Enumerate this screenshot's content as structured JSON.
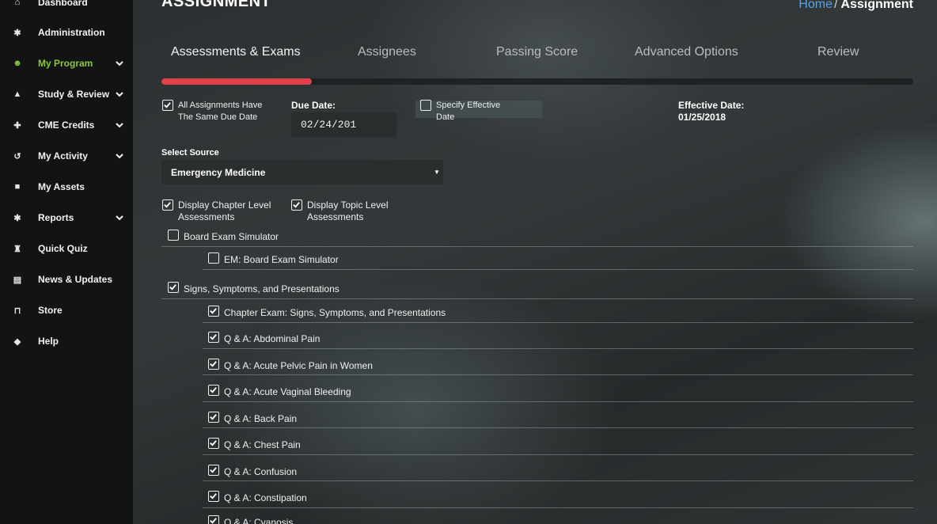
{
  "sidebar": {
    "items": [
      {
        "label": "Dashboard",
        "icon": "home-icon",
        "glyph": "⌂"
      },
      {
        "label": "Administration",
        "icon": "tools-icon",
        "glyph": "✱"
      },
      {
        "label": "My Program",
        "icon": "users-icon",
        "glyph": "☻"
      },
      {
        "label": "Study & Review",
        "icon": "graduation-cap-icon",
        "glyph": "▲"
      },
      {
        "label": "CME Credits",
        "icon": "badge-icon",
        "glyph": "✚"
      },
      {
        "label": "My Activity",
        "icon": "history-icon",
        "glyph": "↺"
      },
      {
        "label": "My Assets",
        "icon": "book-icon",
        "glyph": "■"
      },
      {
        "label": "Reports",
        "icon": "wrench-icon",
        "glyph": "✱"
      },
      {
        "label": "Quick Quiz",
        "icon": "trophy-icon",
        "glyph": "♜"
      },
      {
        "label": "News & Updates",
        "icon": "newspaper-icon",
        "glyph": "▤"
      },
      {
        "label": "Store",
        "icon": "cart-icon",
        "glyph": "⊓"
      },
      {
        "label": "Help",
        "icon": "gamepad-icon",
        "glyph": "◆"
      }
    ],
    "active_color": "#8cc63f"
  },
  "header": {
    "title": "ASSIGNMENT",
    "breadcrumb": {
      "home": "Home",
      "separator": "/",
      "current": "Assignment"
    }
  },
  "tabs": [
    {
      "label": "Assessments & Exams"
    },
    {
      "label": "Assignees"
    },
    {
      "label": "Passing Score"
    },
    {
      "label": "Advanced Options"
    },
    {
      "label": "Review"
    }
  ],
  "progress": {
    "percent": 20,
    "color": "#e0414b"
  },
  "options": {
    "same_due_date": {
      "label": "All Assignments Have The Same Due Date",
      "checked": true
    },
    "due_date": {
      "label": "Due Date:",
      "value": "02/24/201"
    },
    "specify_effective": {
      "label": "Specify Effective Date",
      "checked": false
    },
    "effective_date": {
      "label": "Effective Date:",
      "value": "01/25/2018"
    }
  },
  "source": {
    "label": "Select Source",
    "selected": "Emergency Medicine"
  },
  "display": {
    "chapter_level": {
      "label": "Display Chapter Level Assessments",
      "checked": true
    },
    "topic_level": {
      "label": "Display Topic Level Assessments",
      "checked": true
    }
  },
  "tree": [
    {
      "label": "Board Exam Simulator",
      "level": 0,
      "checked": false
    },
    {
      "label": "EM: Board Exam Simulator",
      "level": 1,
      "checked": false
    },
    {
      "label": "Signs, Symptoms, and Presentations",
      "level": 0,
      "checked": true
    },
    {
      "label": "Chapter Exam: Signs, Symptoms, and Presentations",
      "level": 1,
      "checked": true
    },
    {
      "label": "Q & A: Abdominal Pain",
      "level": 1,
      "checked": true
    },
    {
      "label": "Q & A: Acute Pelvic Pain in Women",
      "level": 1,
      "checked": true
    },
    {
      "label": "Q & A: Acute Vaginal Bleeding",
      "level": 1,
      "checked": true
    },
    {
      "label": "Q & A: Back Pain",
      "level": 1,
      "checked": true
    },
    {
      "label": "Q & A: Chest Pain",
      "level": 1,
      "checked": true
    },
    {
      "label": "Q & A: Confusion",
      "level": 1,
      "checked": true
    },
    {
      "label": "Q & A: Constipation",
      "level": 1,
      "checked": true
    },
    {
      "label": "Q & A: Cyanosis",
      "level": 1,
      "checked": true
    }
  ]
}
